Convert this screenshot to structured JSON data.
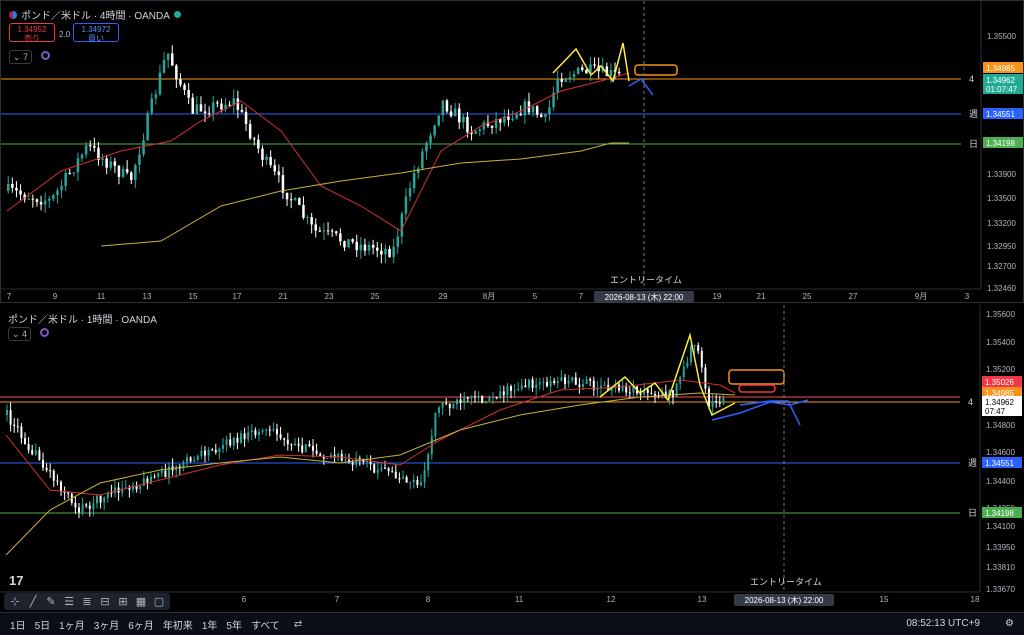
{
  "pane1": {
    "title": "ポンド／米ドル · 4時間 · OANDA",
    "sell_price": "1.34952",
    "sell_label": "売り",
    "spread": "2.0",
    "buy_price": "1.34972",
    "buy_label": "買い",
    "indicator_count": "7",
    "price_ticks": [
      "1.35500",
      "1.34985",
      "1.34962",
      "01:07:47",
      "1.34551",
      "1.34198",
      "1.33900",
      "1.33600",
      "1.33500",
      "1.33200",
      "1.32950",
      "1.32700",
      "1.32460"
    ],
    "badges": [
      {
        "label": "1.34985",
        "color": "#f7931a"
      },
      {
        "label": "1.34962",
        "color": "#22ab94"
      },
      {
        "label": "01:07:47",
        "color": "#22ab94"
      },
      {
        "label": "1.34551",
        "color": "#2962ff"
      },
      {
        "label": "1.34198",
        "color": "#4caf50"
      }
    ],
    "line_labels": [
      "4",
      "週",
      "日"
    ],
    "time_ticks": [
      "7",
      "9",
      "11",
      "13",
      "15",
      "17",
      "21",
      "23",
      "25",
      "29",
      "8月",
      "5",
      "7",
      "11",
      "19",
      "21",
      "25",
      "27",
      "9月",
      "3"
    ],
    "entry_label": "エントリータイム",
    "entry_date": "2026-08-13 (木)  22:00"
  },
  "pane2": {
    "title": "ポンド／米ドル · 1時間 · OANDA",
    "indicator_count": "4",
    "price_ticks": [
      "1.35600",
      "1.35400",
      "1.35200",
      "1.35000",
      "1.34800",
      "1.34600",
      "1.34400",
      "1.34250",
      "1.34100",
      "1.33950",
      "1.33810",
      "1.33670"
    ],
    "badges": [
      {
        "label": "1.35026",
        "color": "#f23645"
      },
      {
        "label": "1.34985",
        "color": "#f7931a"
      },
      {
        "label": "1.34962",
        "color": "#ffffff"
      },
      {
        "label": "07:47",
        "color": "#ffffff"
      },
      {
        "label": "1.34551",
        "color": "#2962ff"
      },
      {
        "label": "1.34198",
        "color": "#4caf50"
      }
    ],
    "line_labels": [
      "4",
      "週",
      "日"
    ],
    "time_ticks": [
      "6",
      "7",
      "8",
      "11",
      "12",
      "13",
      "15",
      "18"
    ],
    "entry_label": "エントリータイム",
    "entry_date": "2026-08-13 (木)  22:00"
  },
  "bottom_bar": {
    "timeframes": [
      "1日",
      "5日",
      "1ヶ月",
      "3ヶ月",
      "6ヶ月",
      "年初来",
      "1年",
      "5年",
      "すべて"
    ],
    "clock": "08:52:13 UTC+9",
    "percent": "%",
    "log": "log",
    "auto": "auto"
  },
  "colors": {
    "bull": "#26a69a",
    "bear": "#ef5350",
    "white_candle": "#ffffff",
    "resistance": "#f7931a",
    "weekly": "#2962ff",
    "daily": "#4caf50",
    "ma_fast": "#d32f2f",
    "ma_slow": "#c9b037",
    "zigzag": "#ffeb3b"
  }
}
